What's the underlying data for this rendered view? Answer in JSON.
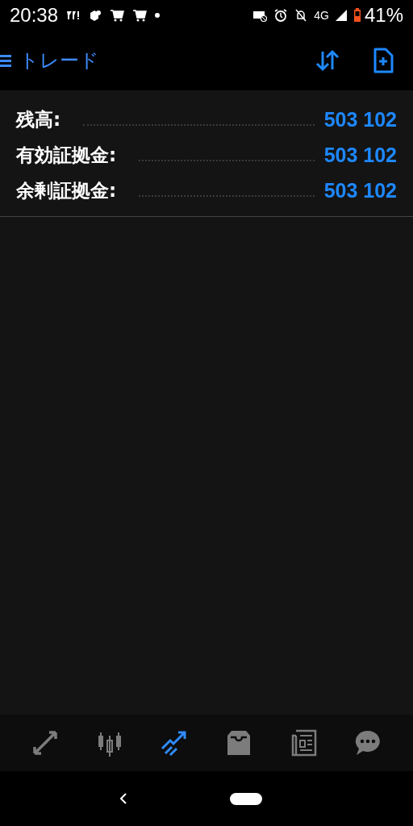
{
  "status_bar": {
    "time": "20:38",
    "network": "4G",
    "battery": "41%"
  },
  "toolbar": {
    "title": "トレード"
  },
  "summary": [
    {
      "label": "残高:",
      "value": "503 102"
    },
    {
      "label": "有効証拠金:",
      "value": "503 102"
    },
    {
      "label": "余剰証拠金:",
      "value": "503 102"
    }
  ],
  "bottom_nav": [
    {
      "kind": "quotes",
      "selected": false
    },
    {
      "kind": "chart",
      "selected": false
    },
    {
      "kind": "trade",
      "selected": true
    },
    {
      "kind": "history",
      "selected": false
    },
    {
      "kind": "news",
      "selected": false
    },
    {
      "kind": "chat",
      "selected": false
    }
  ]
}
